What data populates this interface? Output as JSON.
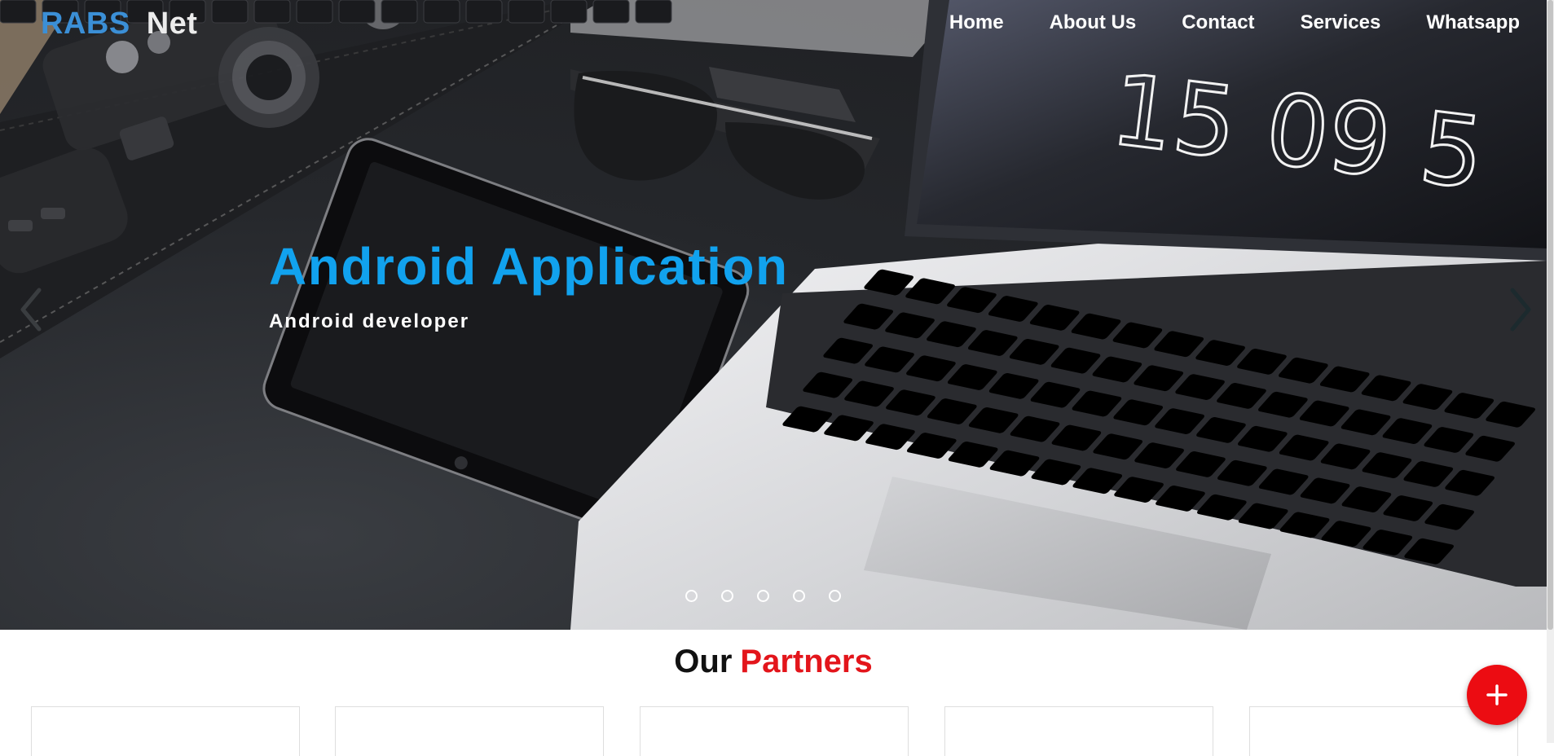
{
  "brand": {
    "part1": "RABS",
    "part2": "Net",
    "part1_color": "#3b8fd6",
    "part2_color": "#ececec"
  },
  "nav": {
    "items": [
      {
        "label": "Home"
      },
      {
        "label": "About Us"
      },
      {
        "label": "Contact"
      },
      {
        "label": "Services"
      },
      {
        "label": "Whatsapp"
      }
    ]
  },
  "hero": {
    "title": "Android Application",
    "subtitle": "Android developer",
    "title_color": "#11a2ee",
    "clock_digits": "15 09 5",
    "slide_count": 5,
    "icons": {
      "prev": "chevron-left-icon",
      "next": "chevron-right-icon"
    }
  },
  "partners": {
    "title_word1": "Our",
    "title_word2": "Partners",
    "title_word2_color": "#e3151b",
    "card_count": 5
  },
  "fab": {
    "icon": "plus-icon",
    "color": "#ec0c12"
  }
}
